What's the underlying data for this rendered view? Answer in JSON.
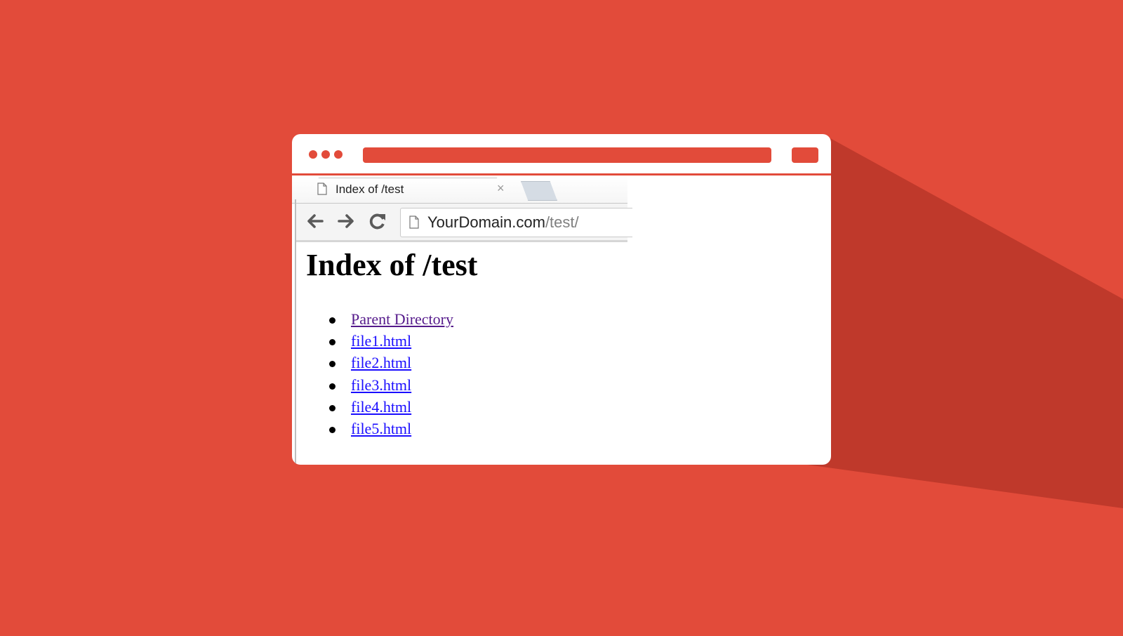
{
  "theme": {
    "background": "#e24b3a",
    "shadow": "#bf392b",
    "window_bg": "#ffffff",
    "link_color": "#1a0dff",
    "visited_link_color": "#551a8b"
  },
  "browser": {
    "tab": {
      "title": "Index of /test",
      "icon": "page-icon",
      "close_icon": "close-icon",
      "close_glyph": "×"
    },
    "new_tab_icon": "new-tab-icon",
    "nav": {
      "back_icon": "back-arrow-icon",
      "forward_icon": "forward-arrow-icon",
      "reload_icon": "reload-icon"
    },
    "address": {
      "icon": "page-icon",
      "domain": "YourDomain.com",
      "path": "/test/"
    }
  },
  "page": {
    "heading": "Index of /test",
    "links": [
      {
        "label": "Parent Directory",
        "visited": true
      },
      {
        "label": "file1.html",
        "visited": false
      },
      {
        "label": "file2.html",
        "visited": false
      },
      {
        "label": "file3.html",
        "visited": false
      },
      {
        "label": "file4.html",
        "visited": false
      },
      {
        "label": "file5.html",
        "visited": false
      }
    ]
  }
}
